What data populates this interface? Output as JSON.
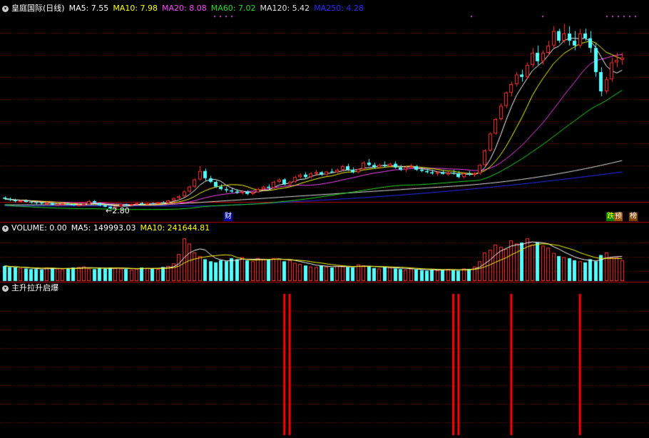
{
  "panel1": {
    "stock_label": "皇庭国际(日线)",
    "toggle_glyph": "▾",
    "indicators": [
      {
        "label": "MA5: 7.55",
        "color": "#ffffff"
      },
      {
        "label": "MA10: 7.98",
        "color": "#ffff00"
      },
      {
        "label": "MA20: 8.08",
        "color": "#ff44ff"
      },
      {
        "label": "MA60: 7.02",
        "color": "#22dd22"
      },
      {
        "label": "MA120: 5.42",
        "color": "#e0e0e0"
      },
      {
        "label": "MA250: 4.28",
        "color": "#2b2bff"
      }
    ]
  },
  "panel2": {
    "toggle_glyph": "▾",
    "indicators": [
      {
        "label": "VOLUME: 0.00",
        "color": "#ffffff"
      },
      {
        "label": "MA5: 149993.03",
        "color": "#ffffff"
      },
      {
        "label": "MA10: 241644.81",
        "color": "#ffff00"
      }
    ]
  },
  "panel3": {
    "toggle_glyph": "▾",
    "title": "主升拉升启爆"
  },
  "annotations": {
    "low_label": "←2.80",
    "badge_cai": "财",
    "badge_2a": "跌",
    "badge_2b": "预",
    "badge_3": "榜"
  },
  "colors": {
    "up": "#ff3232",
    "down": "#54fcfc",
    "signal": "#ff0000",
    "grid": "#8b0000",
    "sep": "#c00000"
  },
  "chart_data": {
    "type": "candlestick",
    "series_lines": [
      "MA5",
      "MA10",
      "MA20",
      "MA60",
      "MA120",
      "MA250"
    ],
    "low_marker": 2.8,
    "candles_ohlc": [
      [
        3.3,
        3.35,
        3.2,
        3.25
      ],
      [
        3.25,
        3.3,
        3.15,
        3.2
      ],
      [
        3.2,
        3.25,
        3.1,
        3.15
      ],
      [
        3.15,
        3.2,
        3.1,
        3.18
      ],
      [
        3.18,
        3.22,
        3.1,
        3.12
      ],
      [
        3.12,
        3.18,
        3.05,
        3.1
      ],
      [
        3.1,
        3.15,
        3.02,
        3.08
      ],
      [
        3.08,
        3.12,
        3.0,
        3.05
      ],
      [
        3.05,
        3.1,
        3.0,
        3.07
      ],
      [
        3.07,
        3.1,
        2.98,
        3.0
      ],
      [
        3.0,
        3.05,
        2.95,
        3.02
      ],
      [
        3.02,
        3.08,
        2.98,
        3.04
      ],
      [
        3.04,
        3.1,
        3.0,
        3.02
      ],
      [
        3.02,
        3.05,
        2.96,
        2.98
      ],
      [
        2.98,
        3.02,
        2.94,
        3.0
      ],
      [
        3.0,
        3.05,
        2.97,
        3.02
      ],
      [
        3.02,
        3.2,
        3.0,
        3.15
      ],
      [
        3.15,
        3.2,
        3.05,
        3.08
      ],
      [
        3.08,
        3.1,
        2.95,
        2.98
      ],
      [
        2.98,
        3.0,
        2.9,
        2.92
      ],
      [
        2.92,
        2.95,
        2.8,
        2.85
      ],
      [
        2.85,
        2.95,
        2.82,
        2.93
      ],
      [
        2.93,
        3.05,
        2.9,
        3.02
      ],
      [
        3.02,
        3.05,
        2.95,
        2.98
      ],
      [
        2.98,
        3.05,
        2.95,
        3.03
      ],
      [
        3.03,
        3.1,
        3.0,
        3.07
      ],
      [
        3.07,
        3.12,
        3.0,
        3.02
      ],
      [
        3.02,
        3.08,
        3.0,
        3.06
      ],
      [
        3.06,
        3.1,
        3.02,
        3.05
      ],
      [
        3.05,
        3.12,
        3.03,
        3.1
      ],
      [
        3.1,
        3.15,
        3.05,
        3.08
      ],
      [
        3.08,
        3.2,
        3.06,
        3.18
      ],
      [
        3.18,
        3.3,
        3.15,
        3.28
      ],
      [
        3.28,
        3.4,
        3.2,
        3.35
      ],
      [
        3.35,
        3.6,
        3.3,
        3.55
      ],
      [
        3.55,
        3.8,
        3.5,
        3.75
      ],
      [
        3.75,
        4.1,
        3.7,
        4.05
      ],
      [
        4.05,
        4.6,
        4.0,
        4.4
      ],
      [
        4.4,
        4.5,
        4.0,
        4.1
      ],
      [
        4.1,
        4.2,
        3.9,
        3.95
      ],
      [
        3.95,
        4.0,
        3.7,
        3.75
      ],
      [
        3.75,
        3.85,
        3.6,
        3.65
      ],
      [
        3.65,
        3.75,
        3.5,
        3.6
      ],
      [
        3.6,
        3.7,
        3.5,
        3.55
      ],
      [
        3.55,
        3.65,
        3.45,
        3.5
      ],
      [
        3.5,
        3.6,
        3.42,
        3.55
      ],
      [
        3.55,
        3.6,
        3.4,
        3.45
      ],
      [
        3.45,
        3.55,
        3.4,
        3.52
      ],
      [
        3.52,
        3.7,
        3.5,
        3.65
      ],
      [
        3.65,
        3.8,
        3.6,
        3.75
      ],
      [
        3.75,
        3.85,
        3.6,
        3.7
      ],
      [
        3.7,
        4.0,
        3.65,
        3.95
      ],
      [
        3.95,
        4.1,
        3.9,
        4.05
      ],
      [
        4.05,
        4.1,
        3.8,
        3.85
      ],
      [
        3.85,
        4.0,
        3.8,
        3.95
      ],
      [
        3.95,
        4.2,
        3.9,
        4.15
      ],
      [
        4.15,
        4.3,
        4.1,
        4.25
      ],
      [
        4.25,
        4.35,
        4.1,
        4.15
      ],
      [
        4.15,
        4.35,
        4.1,
        4.3
      ],
      [
        4.3,
        4.45,
        4.2,
        4.35
      ],
      [
        4.35,
        4.4,
        4.2,
        4.25
      ],
      [
        4.25,
        4.4,
        4.2,
        4.38
      ],
      [
        4.38,
        4.5,
        4.3,
        4.35
      ],
      [
        4.35,
        4.5,
        4.3,
        4.45
      ],
      [
        4.45,
        4.65,
        4.4,
        4.6
      ],
      [
        4.6,
        4.7,
        4.4,
        4.45
      ],
      [
        4.45,
        4.55,
        4.3,
        4.35
      ],
      [
        4.35,
        4.5,
        4.3,
        4.48
      ],
      [
        4.48,
        4.8,
        4.45,
        4.75
      ],
      [
        4.75,
        4.9,
        4.6,
        4.65
      ],
      [
        4.65,
        4.75,
        4.5,
        4.55
      ],
      [
        4.55,
        4.7,
        4.5,
        4.65
      ],
      [
        4.65,
        4.8,
        4.55,
        4.6
      ],
      [
        4.6,
        4.75,
        4.55,
        4.7
      ],
      [
        4.7,
        4.8,
        4.5,
        4.55
      ],
      [
        4.55,
        4.65,
        4.4,
        4.45
      ],
      [
        4.45,
        4.6,
        4.35,
        4.55
      ],
      [
        4.55,
        4.7,
        4.5,
        4.6
      ],
      [
        4.6,
        4.65,
        4.4,
        4.45
      ],
      [
        4.45,
        4.55,
        4.35,
        4.4
      ],
      [
        4.4,
        4.5,
        4.3,
        4.35
      ],
      [
        4.35,
        4.45,
        4.25,
        4.3
      ],
      [
        4.3,
        4.4,
        4.2,
        4.35
      ],
      [
        4.35,
        4.45,
        4.25,
        4.28
      ],
      [
        4.28,
        4.4,
        4.2,
        4.32
      ],
      [
        4.32,
        4.45,
        4.25,
        4.3
      ],
      [
        4.3,
        4.4,
        4.1,
        4.15
      ],
      [
        4.15,
        4.35,
        4.1,
        4.3
      ],
      [
        4.3,
        4.4,
        4.2,
        4.25
      ],
      [
        4.25,
        4.35,
        4.15,
        4.3
      ],
      [
        4.3,
        4.7,
        4.25,
        4.65
      ],
      [
        4.65,
        5.3,
        4.6,
        5.25
      ],
      [
        5.25,
        6.0,
        5.2,
        5.95
      ],
      [
        5.95,
        6.6,
        5.9,
        6.55
      ],
      [
        6.55,
        7.2,
        6.5,
        7.1
      ],
      [
        7.1,
        7.7,
        7.0,
        7.65
      ],
      [
        7.65,
        8.1,
        7.5,
        8.0
      ],
      [
        8.0,
        8.5,
        7.9,
        8.4
      ],
      [
        8.4,
        8.6,
        8.1,
        8.3
      ],
      [
        8.3,
        8.9,
        8.2,
        8.8
      ],
      [
        8.8,
        9.5,
        8.7,
        9.3
      ],
      [
        9.3,
        9.6,
        8.8,
        8.95
      ],
      [
        8.95,
        9.4,
        8.8,
        9.3
      ],
      [
        9.3,
        9.8,
        9.2,
        9.6
      ],
      [
        9.6,
        10.4,
        9.5,
        10.2
      ],
      [
        10.2,
        10.3,
        9.7,
        9.8
      ],
      [
        9.8,
        10.5,
        9.7,
        10.1
      ],
      [
        10.1,
        10.4,
        9.6,
        9.8
      ],
      [
        9.8,
        10.2,
        9.4,
        9.6
      ],
      [
        9.6,
        10.3,
        9.5,
        10.1
      ],
      [
        10.1,
        10.3,
        9.8,
        9.9
      ],
      [
        9.9,
        10.2,
        9.3,
        9.5
      ],
      [
        9.5,
        9.7,
        8.3,
        8.5
      ],
      [
        8.5,
        8.7,
        7.5,
        7.7
      ],
      [
        7.7,
        8.3,
        7.6,
        8.2
      ],
      [
        8.2,
        9.1,
        8.1,
        8.9
      ],
      [
        8.9,
        9.3,
        8.7,
        9.0
      ],
      [
        9.0,
        9.3,
        8.8,
        9.1
      ]
    ],
    "volume": [
      29,
      27,
      26,
      25,
      24,
      23,
      23,
      22,
      26,
      25,
      24,
      23,
      24,
      26,
      27,
      28,
      24,
      23,
      25,
      24,
      26,
      25,
      24,
      23,
      22,
      24,
      26,
      25,
      24,
      23,
      27,
      29,
      34,
      52,
      82,
      72,
      55,
      48,
      42,
      38,
      36,
      40,
      38,
      44,
      42,
      46,
      40,
      38,
      44,
      42,
      41,
      44,
      42,
      38,
      40,
      35,
      33,
      30,
      28,
      27,
      30,
      28,
      26,
      29,
      28,
      27,
      26,
      32,
      30,
      28,
      25,
      24,
      27,
      26,
      24,
      23,
      22,
      24,
      22,
      21,
      20,
      22,
      21,
      22,
      23,
      21,
      20,
      24,
      23,
      28,
      38,
      55,
      60,
      70,
      66,
      62,
      78,
      72,
      74,
      82,
      70,
      74,
      68,
      64,
      54,
      48,
      46,
      44,
      40,
      38,
      36,
      42,
      38,
      50,
      55,
      45,
      46,
      40
    ],
    "volume_ma5": [],
    "signals_bar_index": [
      53,
      54,
      85,
      86,
      96,
      109
    ]
  }
}
